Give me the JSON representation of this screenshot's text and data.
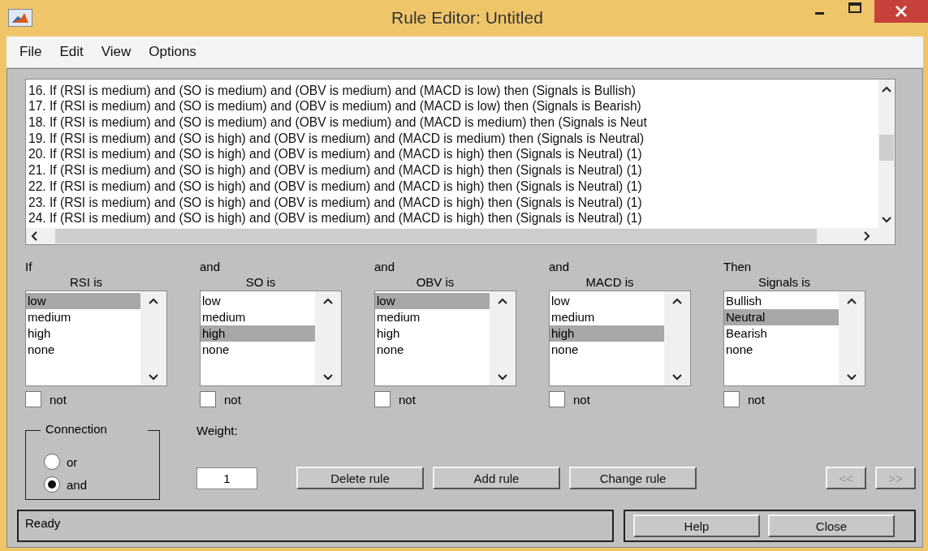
{
  "window": {
    "title": "Rule Editor: Untitled"
  },
  "menu": [
    "File",
    "Edit",
    "View",
    "Options"
  ],
  "rules": [
    "16. If (RSI is medium) and (SO is medium) and (OBV is medium) and (MACD is low) then (Signals is Bullish)",
    "17. If (RSI is medium) and (SO is medium) and (OBV is medium) and (MACD is low) then (Signals is Bearish)",
    "18. If (RSI is medium) and (SO is medium) and (OBV is medium) and (MACD is medium) then (Signals is Neut",
    "19. If (RSI is medium) and (SO is high) and (OBV is medium) and (MACD is medium) then (Signals is Neutral)",
    "20. If (RSI is medium) and (SO is high) and (OBV is medium) and (MACD is high) then (Signals is Neutral) (1)",
    "21. If (RSI is medium) and (SO is high) and (OBV is medium) and (MACD is high) then (Signals is Neutral) (1)",
    "22. If (RSI is medium) and (SO is high) and (OBV is medium) and (MACD is high) then (Signals is Neutral) (1)",
    "23. If (RSI is medium) and (SO is high) and (OBV is medium) and (MACD is high) then (Signals is Neutral) (1)",
    "24. If (RSI is medium) and (SO is high) and (OBV is medium) and (MACD is high) then (Signals is Neutral) (1)"
  ],
  "variables": [
    {
      "connector": "If",
      "name": "RSI is",
      "items": [
        {
          "label": "low",
          "selected": true
        },
        {
          "label": "medium",
          "selected": false
        },
        {
          "label": "high",
          "selected": false
        },
        {
          "label": "none",
          "selected": false
        }
      ],
      "not_label": "not",
      "not_checked": false
    },
    {
      "connector": "and",
      "name": "SO is",
      "items": [
        {
          "label": "low",
          "selected": false
        },
        {
          "label": "medium",
          "selected": false
        },
        {
          "label": "high",
          "selected": true
        },
        {
          "label": "none",
          "selected": false
        }
      ],
      "not_label": "not",
      "not_checked": false
    },
    {
      "connector": "and",
      "name": "OBV is",
      "items": [
        {
          "label": "low",
          "selected": true
        },
        {
          "label": "medium",
          "selected": false
        },
        {
          "label": "high",
          "selected": false
        },
        {
          "label": "none",
          "selected": false
        }
      ],
      "not_label": "not",
      "not_checked": false
    },
    {
      "connector": "and",
      "name": "MACD is",
      "items": [
        {
          "label": "low",
          "selected": false
        },
        {
          "label": "medium",
          "selected": false
        },
        {
          "label": "high",
          "selected": true
        },
        {
          "label": "none",
          "selected": false
        }
      ],
      "not_label": "not",
      "not_checked": false
    },
    {
      "connector": "Then",
      "name": "Signals is",
      "items": [
        {
          "label": "Bullish",
          "selected": false
        },
        {
          "label": "Neutral",
          "selected": true
        },
        {
          "label": "Bearish",
          "selected": false
        },
        {
          "label": "none",
          "selected": false
        }
      ],
      "not_label": "not",
      "not_checked": false
    }
  ],
  "connection": {
    "title": "Connection",
    "options": [
      {
        "label": "or",
        "selected": false
      },
      {
        "label": "and",
        "selected": true
      }
    ]
  },
  "weight": {
    "label": "Weight:",
    "value": "1"
  },
  "actions": [
    {
      "label": "Delete rule",
      "disabled": false
    },
    {
      "label": "Add rule",
      "disabled": false
    },
    {
      "label": "Change rule",
      "disabled": false
    }
  ],
  "nav": [
    {
      "label": "<<",
      "disabled": true
    },
    {
      "label": ">>",
      "disabled": true
    }
  ],
  "status": "Ready",
  "footer_buttons": [
    {
      "label": "Help",
      "disabled": false
    },
    {
      "label": "Close",
      "disabled": false
    }
  ]
}
